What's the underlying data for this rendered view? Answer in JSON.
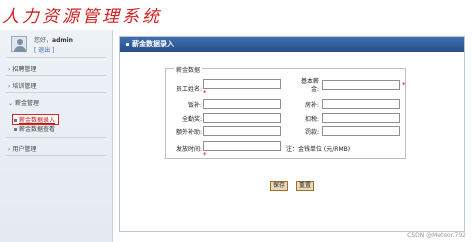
{
  "header": {
    "logo_text": "人力资源管理系统"
  },
  "sidebar": {
    "welcome_prefix": "您好，",
    "username": "admin",
    "logout_label": "[ 退出 ]",
    "menu": {
      "recruit": "招聘管理",
      "training": "培训管理",
      "salary": "薪金管理",
      "salary_entry": "薪金数据录入",
      "salary_query": "薪金数据查看",
      "users": "用户管理"
    }
  },
  "main": {
    "title": "薪金数据录入",
    "fieldset_legend": "薪金数据",
    "fields": {
      "employee_name": {
        "label": "员工姓名:",
        "value": ""
      },
      "base_salary": {
        "label_line1": "基本薪",
        "label_line2": "金:",
        "value": ""
      },
      "meal_allowance": {
        "label": "饭补:",
        "value": ""
      },
      "housing_allowance": {
        "label": "房补:",
        "value": ""
      },
      "full_attendance": {
        "label": "全勤奖:",
        "value": ""
      },
      "deduction": {
        "label": "扣税:",
        "value": ""
      },
      "extra_allowance": {
        "label": "额外补助:",
        "value": ""
      },
      "penalty": {
        "label": "罚款:",
        "value": ""
      },
      "pay_date": {
        "label": "发放时间:",
        "value": ""
      }
    },
    "required_mark": "*",
    "currency_note": "注：金钱单位 (元/RMB)",
    "save_label": "保存",
    "reset_label": "重置"
  },
  "watermark": "CSDN @Meteor.792"
}
